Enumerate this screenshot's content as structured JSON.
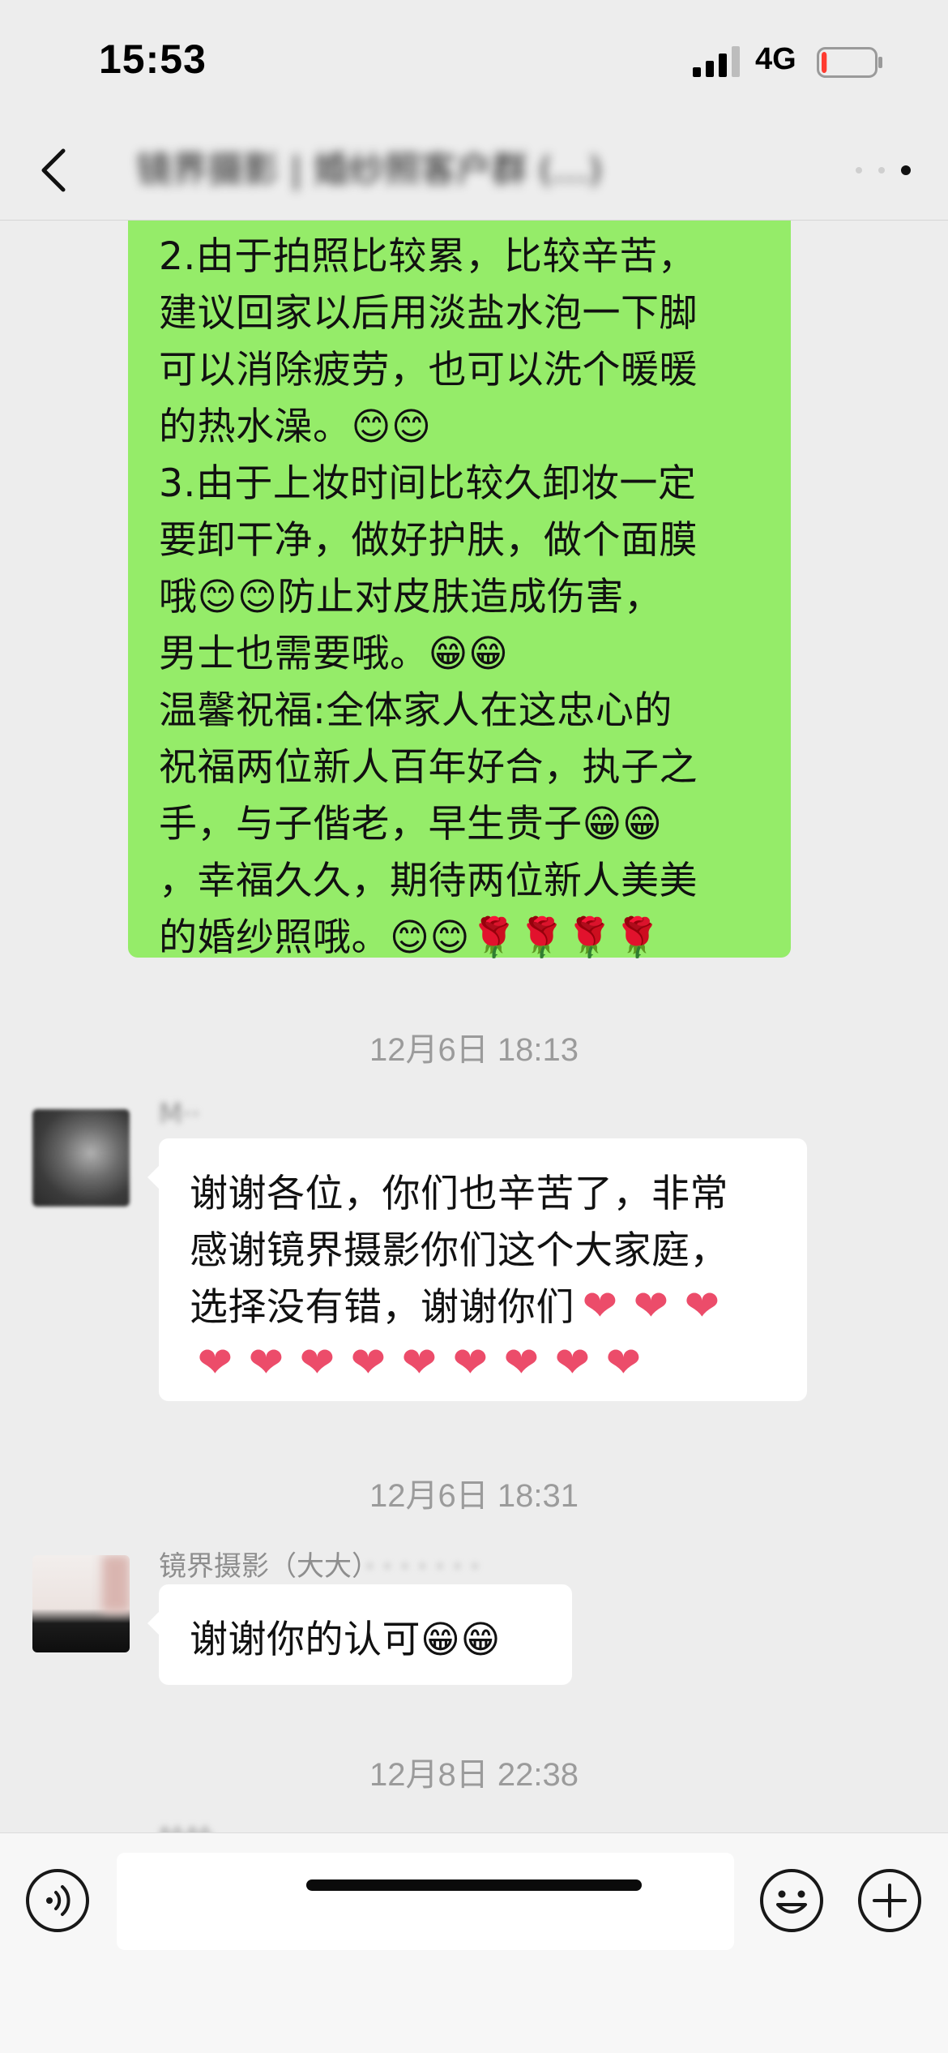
{
  "status_bar": {
    "time": "15:53",
    "network": "4G",
    "battery_level": 0.1,
    "battery_color": "#ff3b30"
  },
  "nav": {
    "title": "镜界摄影 | 婚纱照客户群 (…) ",
    "back_icon": "chevron-left-icon",
    "more_icon": "more-dots-icon"
  },
  "messages": {
    "m1": {
      "sender": "me",
      "bubble_color": "#95ec69",
      "lines": [
        "  2.由于拍照比较累，比较辛苦，",
        "建议回家以后用淡盐水泡一下脚",
        "可以消除疲劳，也可以洗个暖暖",
        "的热水澡。😊😊",
        "3.由于上妆时间比较久卸妆一定",
        "要卸干净，做好护肤，做个面膜",
        "哦😊😊防止对皮肤造成伤害，",
        "男士也需要哦。😁😁",
        "    温馨祝福:全体家人在这忠心的",
        "祝福两位新人百年好合，执子之",
        "手，与子偕老，早生贵子😁😁",
        "，幸福久久，期待两位新人美美",
        "的婚纱照哦。😊😊🌹🌹🌹🌹"
      ]
    },
    "t1": "12月6日 18:13",
    "m2": {
      "sender_name": "M··",
      "lines": [
        "谢谢各位，你们也辛苦了，非常",
        "感谢镜界摄影你们这个大家庭，",
        "选择没有错，谢谢你们❤❤❤",
        "❤❤❤❤❤❤❤❤❤"
      ]
    },
    "t2": "12月6日 18:31",
    "m3": {
      "sender_name": "镜界摄影（大大）",
      "sender_name_blurred": "· · · · · · ·",
      "lines": [
        "谢谢你的认可😁😁"
      ]
    },
    "t3": "12月8日 22:38",
    "m4": {
      "sender_name": "铃铃"
    }
  },
  "input_bar": {
    "placeholder": "",
    "voice_icon": "voice-icon",
    "emoji_icon": "emoji-smile-icon",
    "plus_icon": "plus-circle-icon"
  }
}
